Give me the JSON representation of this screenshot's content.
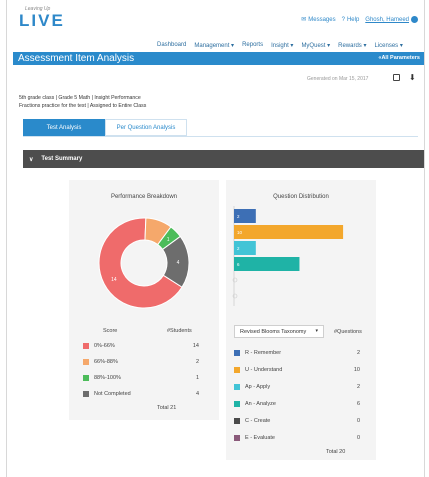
{
  "header": {
    "logo_small": "Leaving Up",
    "logo_big": "LIVE",
    "messages": "Messages",
    "help": "Help",
    "user": "Ghosh, Hameed"
  },
  "nav": [
    "Dashboard",
    "Management ▾",
    "Reports",
    "Insight ▾",
    "MyQuest ▾",
    "Rewards ▾",
    "Licenses ▾"
  ],
  "title": "Assessment Item Analysis",
  "params_link": "«All Parameters",
  "generated": "Generated on Mar 15, 2017",
  "meta": {
    "line1": "5th grade class  |  Grade 5 Math  |  Insight Performance",
    "line2": "Fractions practice for the test  |  Assigned to Entire Class"
  },
  "tabs": [
    "Test Analysis",
    "Per Question Analysis"
  ],
  "summary_label": "Test Summary",
  "performance": {
    "title": "Performance Breakdown",
    "score_header": "Score",
    "students_header": "#Students",
    "rows": [
      {
        "label": "0%-66%",
        "count": "14",
        "color": "#ef6b6b"
      },
      {
        "label": "66%-88%",
        "count": "2",
        "color": "#f5a86b"
      },
      {
        "label": "88%-100%",
        "count": "1",
        "color": "#4cbc5a"
      },
      {
        "label": "Not Completed",
        "count": "4",
        "color": "#6d6d6d"
      }
    ],
    "total": "Total 21",
    "slice_labels": [
      "14",
      "1",
      "4"
    ]
  },
  "distribution": {
    "title": "Question Distribution",
    "taxonomy": "Revised Blooms Taxonomy",
    "questions_header": "#Questions",
    "rows": [
      {
        "label": "R - Remember",
        "count": "2",
        "color": "#3d6fb5"
      },
      {
        "label": "U - Understand",
        "count": "10",
        "color": "#f3a72c"
      },
      {
        "label": "Ap - Apply",
        "count": "2",
        "color": "#42c4d6"
      },
      {
        "label": "An - Analyze",
        "count": "6",
        "color": "#1fb3a6"
      },
      {
        "label": "C - Create",
        "count": "0",
        "color": "#4a4a4a"
      },
      {
        "label": "E - Evaluate",
        "count": "0",
        "color": "#8a5a7a"
      }
    ],
    "total": "Total 20",
    "bar_labels": [
      "2",
      "10",
      "2",
      "6",
      "0",
      "0"
    ]
  },
  "chart_data": [
    {
      "type": "pie",
      "title": "Performance Breakdown",
      "categories": [
        "0%-66%",
        "66%-88%",
        "88%-100%",
        "Not Completed"
      ],
      "values": [
        14,
        2,
        1,
        4
      ]
    },
    {
      "type": "bar",
      "title": "Question Distribution",
      "categories": [
        "R - Remember",
        "U - Understand",
        "Ap - Apply",
        "An - Analyze",
        "C - Create",
        "E - Evaluate"
      ],
      "values": [
        2,
        10,
        2,
        6,
        0,
        0
      ]
    }
  ]
}
